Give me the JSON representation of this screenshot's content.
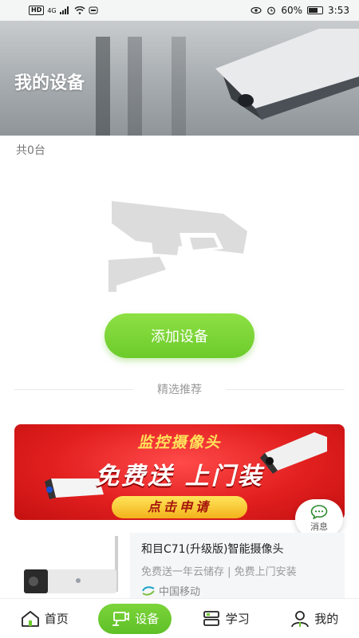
{
  "status_bar": {
    "badge": "HD",
    "network": "4G",
    "battery": "60%",
    "time": "3:53"
  },
  "header": {
    "title": "我的设备"
  },
  "devices": {
    "count_text": "共0台",
    "add_button": "添加设备"
  },
  "featured": {
    "section_title": "精选推荐",
    "promo": {
      "headline": "监控摄像头",
      "main_text": "免费送  上门装",
      "cta": "点击申请"
    }
  },
  "message_button": {
    "label": "消息"
  },
  "product": {
    "title": "和目C71(升级版)智能摄像头",
    "subtitle": "免费送一年云储存 | 免费上门安装",
    "vendor": "中国移动"
  },
  "tabbar": {
    "items": [
      {
        "label": "首页",
        "icon": "home-icon",
        "active": false
      },
      {
        "label": "设备",
        "icon": "device-icon",
        "active": true
      },
      {
        "label": "学习",
        "icon": "learn-icon",
        "active": false
      },
      {
        "label": "我的",
        "icon": "profile-icon",
        "active": false
      }
    ]
  },
  "colors": {
    "accent_green": "#6ccb2c",
    "promo_red": "#e21f1f",
    "promo_yellow": "#ffe35a"
  }
}
